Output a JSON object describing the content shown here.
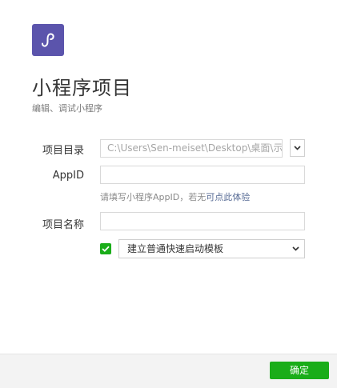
{
  "header": {
    "logo_icon": "mini-program-logo-icon",
    "title": "小程序项目",
    "subtitle": "编辑、调试小程序"
  },
  "form": {
    "directory": {
      "label": "项目目录",
      "value": "C:\\Users\\Sen-meiset\\Desktop\\桌面\\示例"
    },
    "appid": {
      "label": "AppID",
      "value": "",
      "hint": "请填写小程序AppID，若无",
      "hint_link": "可点此体验"
    },
    "project_name": {
      "label": "项目名称",
      "value": ""
    },
    "template": {
      "checked": true,
      "selected": "建立普通快速启动模板"
    }
  },
  "footer": {
    "ok_label": "确定"
  },
  "colors": {
    "brand_purple": "#5b54ac",
    "accent_green": "#1aad19",
    "link_blue": "#576b95"
  }
}
